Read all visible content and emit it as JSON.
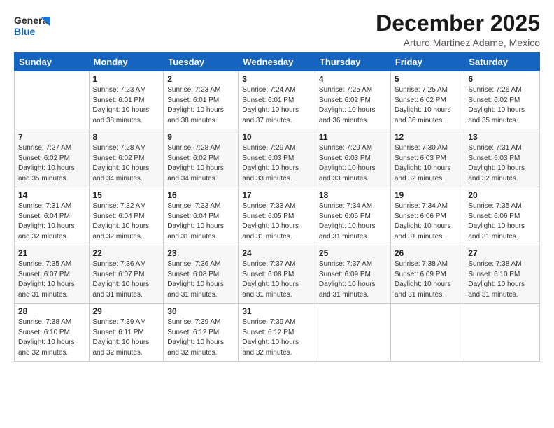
{
  "logo": {
    "line1": "General",
    "line2": "Blue"
  },
  "title": "December 2025",
  "location": "Arturo Martinez Adame, Mexico",
  "days_header": [
    "Sunday",
    "Monday",
    "Tuesday",
    "Wednesday",
    "Thursday",
    "Friday",
    "Saturday"
  ],
  "weeks": [
    [
      {
        "day": "",
        "info": ""
      },
      {
        "day": "1",
        "info": "Sunrise: 7:23 AM\nSunset: 6:01 PM\nDaylight: 10 hours\nand 38 minutes."
      },
      {
        "day": "2",
        "info": "Sunrise: 7:23 AM\nSunset: 6:01 PM\nDaylight: 10 hours\nand 38 minutes."
      },
      {
        "day": "3",
        "info": "Sunrise: 7:24 AM\nSunset: 6:01 PM\nDaylight: 10 hours\nand 37 minutes."
      },
      {
        "day": "4",
        "info": "Sunrise: 7:25 AM\nSunset: 6:02 PM\nDaylight: 10 hours\nand 36 minutes."
      },
      {
        "day": "5",
        "info": "Sunrise: 7:25 AM\nSunset: 6:02 PM\nDaylight: 10 hours\nand 36 minutes."
      },
      {
        "day": "6",
        "info": "Sunrise: 7:26 AM\nSunset: 6:02 PM\nDaylight: 10 hours\nand 35 minutes."
      }
    ],
    [
      {
        "day": "7",
        "info": "Sunrise: 7:27 AM\nSunset: 6:02 PM\nDaylight: 10 hours\nand 35 minutes."
      },
      {
        "day": "8",
        "info": "Sunrise: 7:28 AM\nSunset: 6:02 PM\nDaylight: 10 hours\nand 34 minutes."
      },
      {
        "day": "9",
        "info": "Sunrise: 7:28 AM\nSunset: 6:02 PM\nDaylight: 10 hours\nand 34 minutes."
      },
      {
        "day": "10",
        "info": "Sunrise: 7:29 AM\nSunset: 6:03 PM\nDaylight: 10 hours\nand 33 minutes."
      },
      {
        "day": "11",
        "info": "Sunrise: 7:29 AM\nSunset: 6:03 PM\nDaylight: 10 hours\nand 33 minutes."
      },
      {
        "day": "12",
        "info": "Sunrise: 7:30 AM\nSunset: 6:03 PM\nDaylight: 10 hours\nand 32 minutes."
      },
      {
        "day": "13",
        "info": "Sunrise: 7:31 AM\nSunset: 6:03 PM\nDaylight: 10 hours\nand 32 minutes."
      }
    ],
    [
      {
        "day": "14",
        "info": "Sunrise: 7:31 AM\nSunset: 6:04 PM\nDaylight: 10 hours\nand 32 minutes."
      },
      {
        "day": "15",
        "info": "Sunrise: 7:32 AM\nSunset: 6:04 PM\nDaylight: 10 hours\nand 32 minutes."
      },
      {
        "day": "16",
        "info": "Sunrise: 7:33 AM\nSunset: 6:04 PM\nDaylight: 10 hours\nand 31 minutes."
      },
      {
        "day": "17",
        "info": "Sunrise: 7:33 AM\nSunset: 6:05 PM\nDaylight: 10 hours\nand 31 minutes."
      },
      {
        "day": "18",
        "info": "Sunrise: 7:34 AM\nSunset: 6:05 PM\nDaylight: 10 hours\nand 31 minutes."
      },
      {
        "day": "19",
        "info": "Sunrise: 7:34 AM\nSunset: 6:06 PM\nDaylight: 10 hours\nand 31 minutes."
      },
      {
        "day": "20",
        "info": "Sunrise: 7:35 AM\nSunset: 6:06 PM\nDaylight: 10 hours\nand 31 minutes."
      }
    ],
    [
      {
        "day": "21",
        "info": "Sunrise: 7:35 AM\nSunset: 6:07 PM\nDaylight: 10 hours\nand 31 minutes."
      },
      {
        "day": "22",
        "info": "Sunrise: 7:36 AM\nSunset: 6:07 PM\nDaylight: 10 hours\nand 31 minutes."
      },
      {
        "day": "23",
        "info": "Sunrise: 7:36 AM\nSunset: 6:08 PM\nDaylight: 10 hours\nand 31 minutes."
      },
      {
        "day": "24",
        "info": "Sunrise: 7:37 AM\nSunset: 6:08 PM\nDaylight: 10 hours\nand 31 minutes."
      },
      {
        "day": "25",
        "info": "Sunrise: 7:37 AM\nSunset: 6:09 PM\nDaylight: 10 hours\nand 31 minutes."
      },
      {
        "day": "26",
        "info": "Sunrise: 7:38 AM\nSunset: 6:09 PM\nDaylight: 10 hours\nand 31 minutes."
      },
      {
        "day": "27",
        "info": "Sunrise: 7:38 AM\nSunset: 6:10 PM\nDaylight: 10 hours\nand 31 minutes."
      }
    ],
    [
      {
        "day": "28",
        "info": "Sunrise: 7:38 AM\nSunset: 6:10 PM\nDaylight: 10 hours\nand 32 minutes."
      },
      {
        "day": "29",
        "info": "Sunrise: 7:39 AM\nSunset: 6:11 PM\nDaylight: 10 hours\nand 32 minutes."
      },
      {
        "day": "30",
        "info": "Sunrise: 7:39 AM\nSunset: 6:12 PM\nDaylight: 10 hours\nand 32 minutes."
      },
      {
        "day": "31",
        "info": "Sunrise: 7:39 AM\nSunset: 6:12 PM\nDaylight: 10 hours\nand 32 minutes."
      },
      {
        "day": "",
        "info": ""
      },
      {
        "day": "",
        "info": ""
      },
      {
        "day": "",
        "info": ""
      }
    ]
  ]
}
